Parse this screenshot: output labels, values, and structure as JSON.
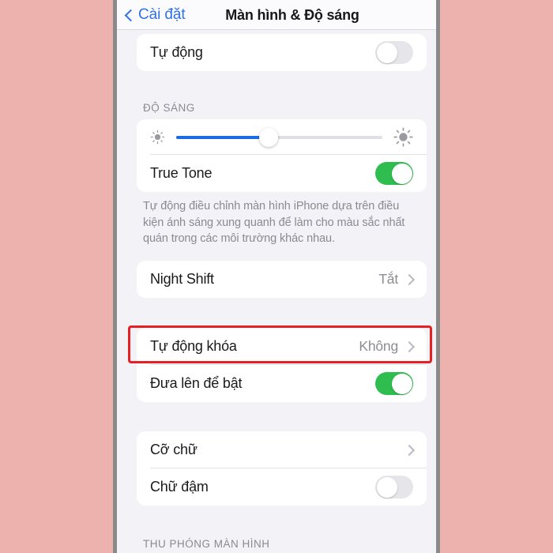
{
  "theme": {
    "page_background": "#edb1ae",
    "screen_background": "#f2f2f7",
    "accent_blue": "#2f71e8",
    "toggle_on_green": "#2fbd4f",
    "slider_blue": "#1b6ce4",
    "highlight_red": "#e81f25"
  },
  "nav": {
    "back_label": "Cài đặt",
    "title": "Màn hình & Độ sáng"
  },
  "auto_section": {
    "rows": [
      {
        "label": "Tự động",
        "control": "toggle",
        "state": "off"
      }
    ]
  },
  "brightness_section": {
    "header": "ĐỘ SÁNG",
    "slider": {
      "value_percent": 45,
      "low_icon": "sun-small-icon",
      "high_icon": "sun-large-icon"
    },
    "rows": [
      {
        "label": "True Tone",
        "control": "toggle",
        "state": "on"
      }
    ],
    "footer_note": "Tự động điều chỉnh màn hình iPhone dựa trên điều kiện ánh sáng xung quanh để làm cho màu sắc nhất quán trong các môi trường khác nhau."
  },
  "night_shift_section": {
    "rows": [
      {
        "label": "Night Shift",
        "value": "Tắt",
        "control": "chevron"
      }
    ]
  },
  "lock_section": {
    "rows": [
      {
        "label": "Tự động khóa",
        "value": "Không",
        "control": "chevron",
        "highlighted": true
      },
      {
        "label": "Đưa lên để bật",
        "control": "toggle",
        "state": "on"
      }
    ]
  },
  "text_section": {
    "rows": [
      {
        "label": "Cỡ chữ",
        "control": "chevron"
      },
      {
        "label": "Chữ đậm",
        "control": "toggle",
        "state": "off"
      }
    ]
  },
  "zoom_section": {
    "header": "THU PHÓNG MÀN HÌNH"
  }
}
